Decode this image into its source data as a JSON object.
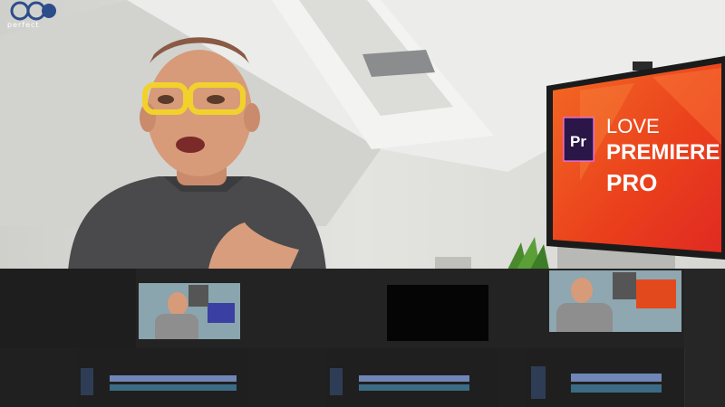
{
  "logo": {
    "name": "max",
    "tagline": "perfect"
  },
  "monitor": {
    "app_badge": "Pr",
    "line1": "LOVE",
    "line2": "PREMIERE",
    "line3": "PRO"
  },
  "colors": {
    "wall": "#dcdcd8",
    "ceiling": "#eeeeec",
    "shirt": "#4a4a4c",
    "glasses": "#f2d12c",
    "monitor_orange": "#f05a1e",
    "monitor_red": "#e8321c",
    "premiere_purple": "#2a1747",
    "premiere_text": "#ea77ff",
    "editor_bg": "#1c1c1c"
  }
}
